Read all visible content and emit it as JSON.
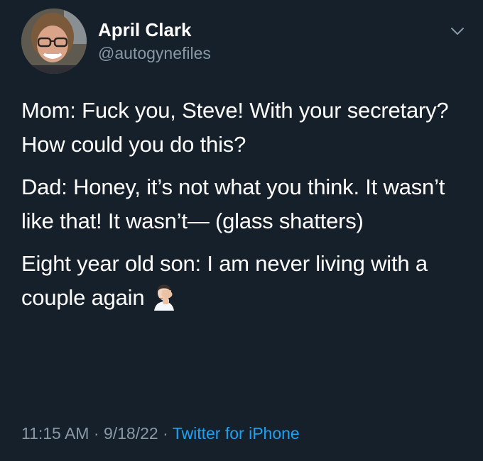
{
  "author": {
    "display_name": "April Clark",
    "handle": "@autogynefiles",
    "avatar_icon": "profile-photo"
  },
  "menu": {
    "icon": "chevron-down-icon"
  },
  "tweet": {
    "paragraphs": [
      "Mom: Fuck you, Steve! With your secretary? How could you do this?",
      "Dad: Honey, it’s not what you think. It wasn’t like that! It wasn’t— (glass shatters)",
      "Eight year old son: I am never living with a couple again"
    ],
    "emoji": "facepalm-emoji"
  },
  "meta": {
    "time": "11:15 AM",
    "date": "9/18/22",
    "separator": "·",
    "source": "Twitter for iPhone"
  },
  "colors": {
    "background": "#15202b",
    "secondary_text": "#8899a6",
    "link": "#1da1f2"
  }
}
